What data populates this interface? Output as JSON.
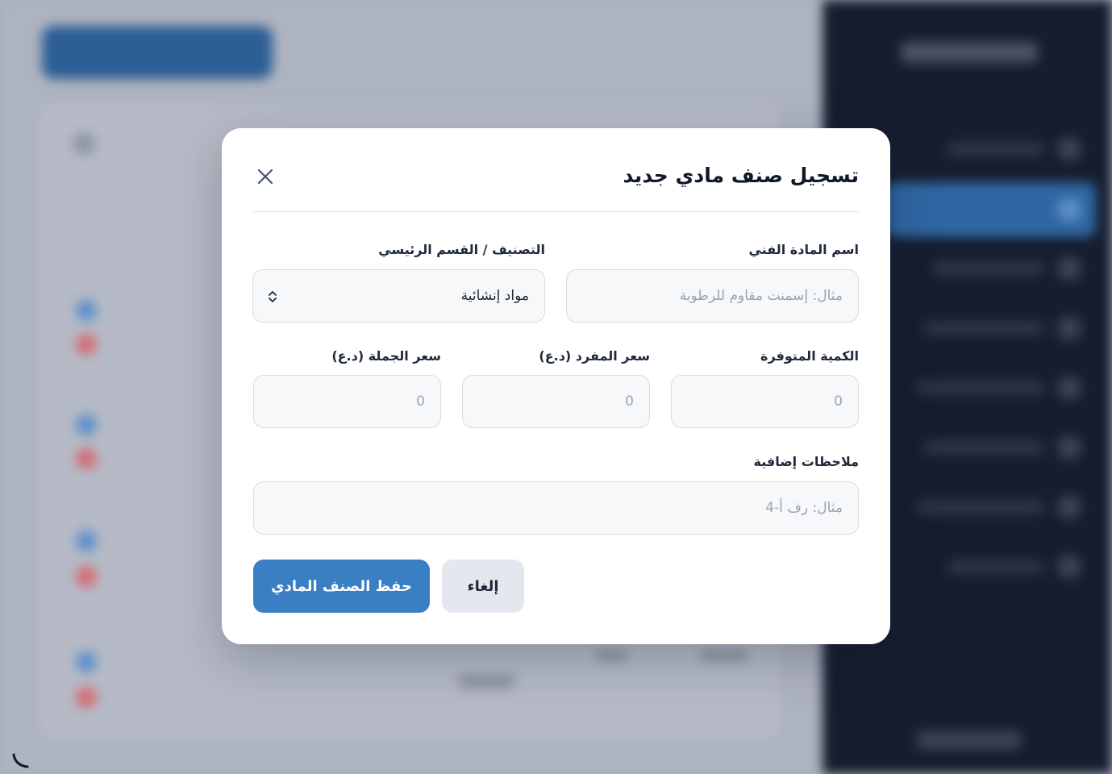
{
  "modal": {
    "title": "تسجيل صنف مادي جديد",
    "fields": {
      "name": {
        "label": "اسم المادة الفني",
        "placeholder": "مثال: إسمنت مقاوم للرطوبة"
      },
      "category": {
        "label": "التصنيف / القسم الرئيسي",
        "value": "مواد إنشائية"
      },
      "quantity": {
        "label": "الكمية المتوفرة",
        "placeholder": "0"
      },
      "unit_price": {
        "label": "سعر المفرد (د.ع)",
        "placeholder": "0"
      },
      "wholesale_price": {
        "label": "سعر الجملة (د.ع)",
        "placeholder": "0"
      },
      "notes": {
        "label": "ملاحظات إضافية",
        "placeholder": "مثال: رف أ-4"
      }
    },
    "buttons": {
      "save": "حفظ الصنف المادي",
      "cancel": "إلغاء"
    }
  },
  "colors": {
    "accent": "#3a7fc4",
    "sidebar": "#161d2e",
    "overlay": "#a9aebb"
  },
  "icons": {
    "close": "close-icon",
    "select": "chevron-up-down-icon"
  }
}
